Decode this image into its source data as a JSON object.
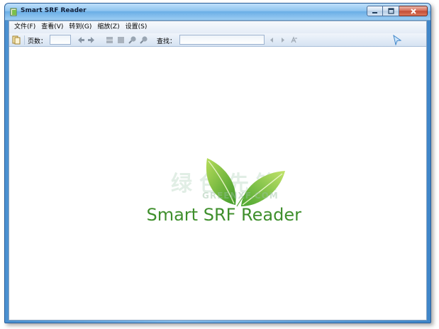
{
  "window": {
    "title": "Smart SRF Reader"
  },
  "menu": {
    "items": [
      {
        "label": "文件(F)"
      },
      {
        "label": "查看(V)"
      },
      {
        "label": "转到(G)"
      },
      {
        "label": "缩放(Z)"
      },
      {
        "label": "设置(S)"
      }
    ]
  },
  "toolbar": {
    "page_label": "页数：",
    "page_value": "",
    "search_label": "查找：",
    "search_value": ""
  },
  "content": {
    "logo_text": "Smart SRF Reader",
    "watermark": "绿色先锋",
    "watermark_sub": "GREENXF.COM"
  },
  "colors": {
    "accent": "#3f8f2c",
    "titlebar": "#8ec4ef",
    "close_button": "#c14a33"
  },
  "icons": [
    "app-icon",
    "minimize-icon",
    "maximize-icon",
    "close-icon",
    "open-file-icon",
    "prev-page-icon",
    "next-page-icon",
    "fit-page-icon",
    "single-page-icon",
    "zoom-in-icon",
    "zoom-out-icon",
    "find-prev-icon",
    "find-next-icon",
    "highlight-icon",
    "cursor-icon"
  ]
}
